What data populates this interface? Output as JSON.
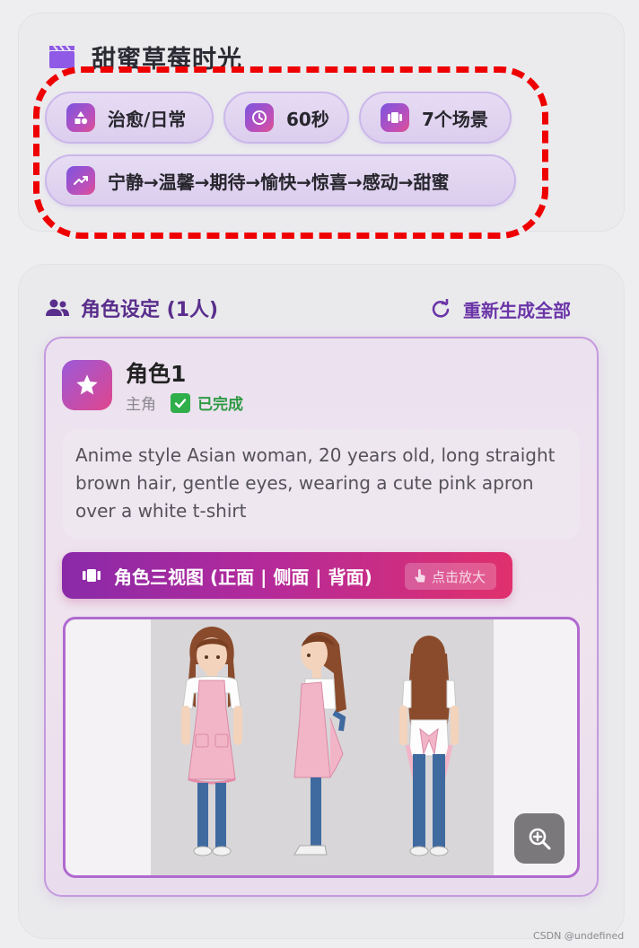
{
  "header": {
    "title": "甜蜜草莓时光",
    "title_icon": "clapperboard-icon"
  },
  "tags": [
    {
      "label": "治愈/日常",
      "icon": "shapes-icon"
    },
    {
      "label": "60秒",
      "icon": "clock-icon"
    },
    {
      "label": "7个场景",
      "icon": "scenes-icon"
    },
    {
      "label": "宁静→温馨→期待→愉快→惊喜→感动→甜蜜",
      "icon": "trend-icon"
    }
  ],
  "characters_section": {
    "title": "角色设定 (1人)",
    "regenerate_label": "重新生成全部",
    "regenerate_icon": "refresh-icon",
    "section_icon": "people-icon",
    "characters": [
      {
        "name": "角色1",
        "type": "主角",
        "status": "已完成",
        "badge_icon": "star-icon",
        "description": "Anime style Asian woman, 20 years old, long straight brown hair, gentle eyes, wearing a cute pink apron over a white t-shirt",
        "three_view_label": "角色三视图 (正面 | 侧面 | 背面)",
        "zoom_hint": "点击放大"
      }
    ]
  },
  "colors": {
    "accent_purple": "#6b35a8",
    "gradient_start": "#8a2aa8",
    "gradient_end": "#e0306d",
    "success_green": "#2f9a45",
    "highlight_dash": "#ef0000"
  },
  "watermark": "CSDN @undefined"
}
